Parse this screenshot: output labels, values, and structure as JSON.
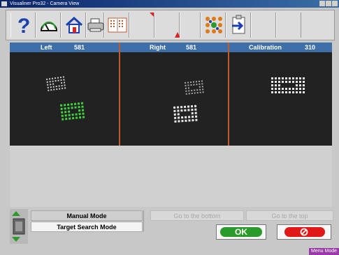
{
  "window": {
    "title": "Visualiner Pro32 - Camera View"
  },
  "panels": [
    {
      "label": "Left",
      "value": "581"
    },
    {
      "label": "Right",
      "value": "581"
    },
    {
      "label": "Calibration",
      "value": "310"
    }
  ],
  "modes": {
    "manual": "Manual Mode",
    "target_search": "Target Search Mode"
  },
  "nav": {
    "bottom": "Go to the bottom",
    "top": "Go to the top"
  },
  "actions": {
    "ok": "OK"
  },
  "status": {
    "menu_mode": "Menu Mode"
  },
  "icons": [
    "help-icon",
    "gauge-icon",
    "home-icon",
    "printer-icon",
    "camera-view-icon",
    "dots-target-icon",
    "clipboard-arrow-icon",
    "cancel-icon"
  ],
  "colors": {
    "header": "#3f6fa8",
    "camera_bg": "#222222",
    "ok": "#2a9a2a",
    "cancel": "#e01818",
    "menu_mode": "#9a3aa8"
  }
}
